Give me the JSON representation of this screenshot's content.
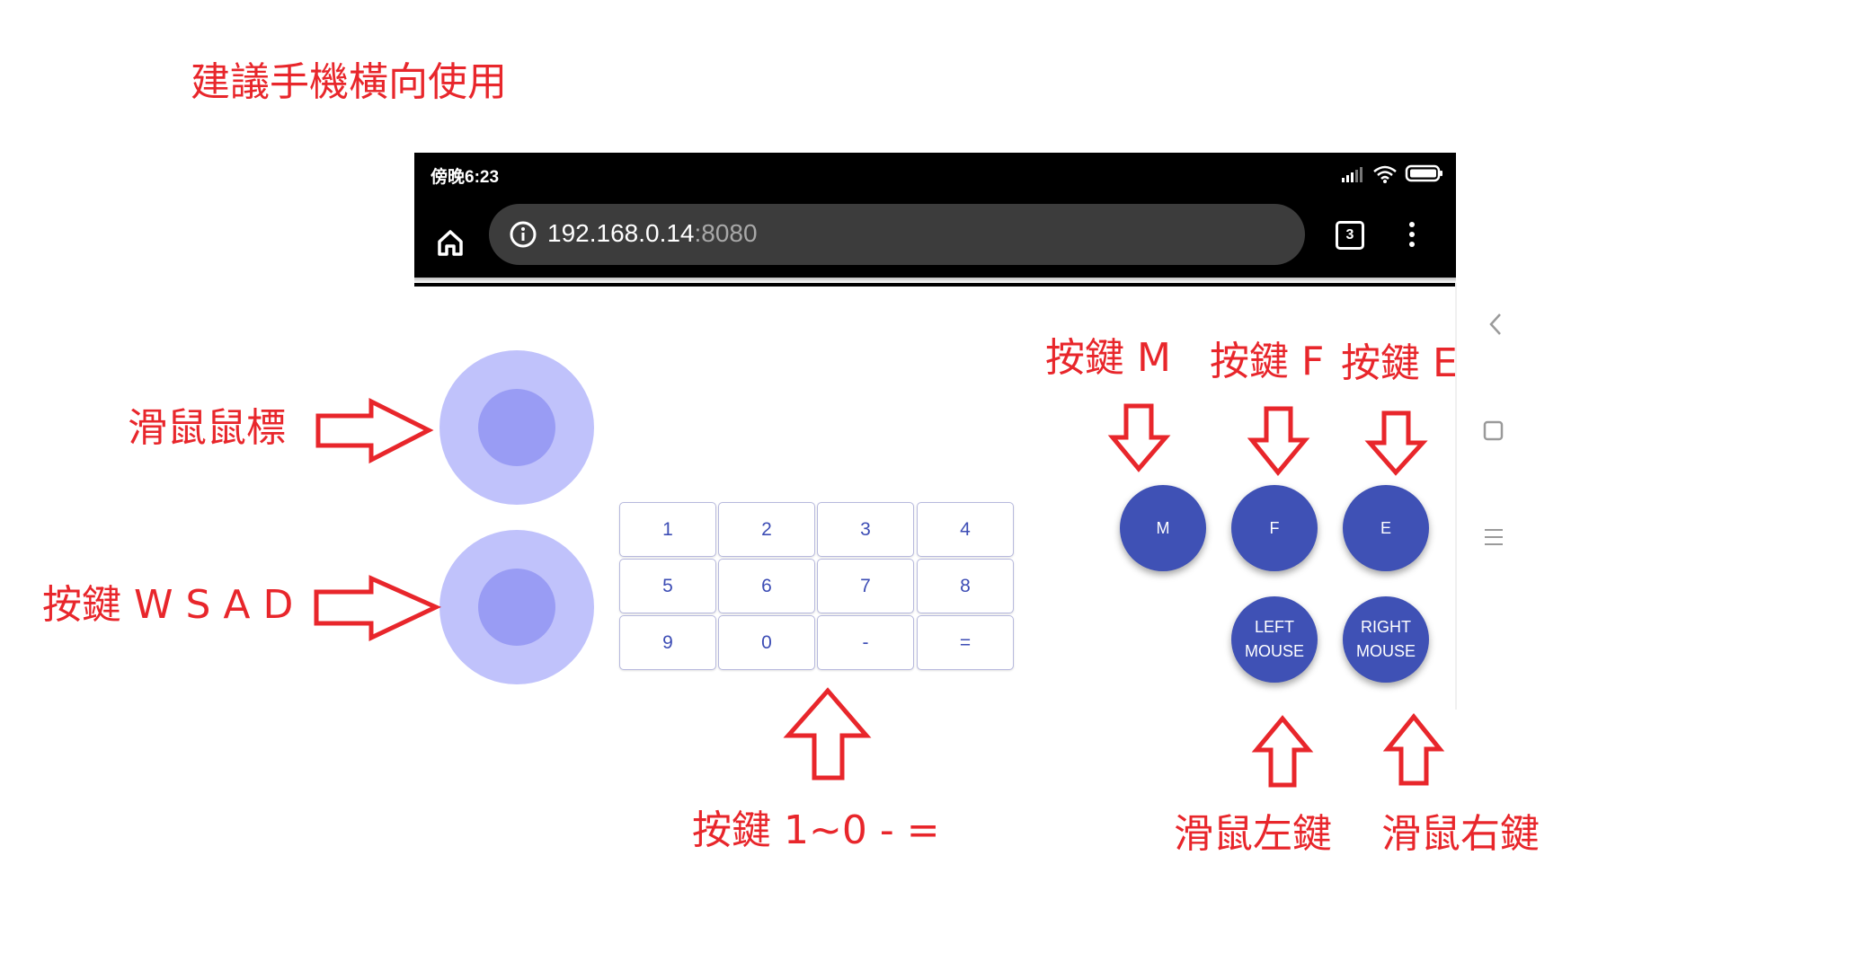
{
  "annotations": {
    "landscape_hint": "建議手機橫向使用",
    "mouse_cursor": "滑鼠鼠標",
    "wsad_keys": "按鍵 W S A D",
    "key_m": "按鍵 M",
    "key_f": "按鍵 F",
    "key_e": "按鍵 E",
    "number_keys": "按鍵 1~0 - =",
    "mouse_left": "滑鼠左鍵",
    "mouse_right": "滑鼠右鍵"
  },
  "status_bar": {
    "time": "傍晚6:23",
    "icons": [
      "signal-icon",
      "wifi-icon",
      "battery-icon"
    ]
  },
  "browser": {
    "url_host": "192.168.0.14",
    "url_port": ":8080",
    "tab_count": "3",
    "icons": [
      "home-icon",
      "info-icon",
      "tabs-icon",
      "more-vert-icon"
    ]
  },
  "side_nav_icons": [
    "back-chevron-icon",
    "square-icon",
    "menu-lines-icon"
  ],
  "keypad": {
    "rows": [
      [
        "1",
        "2",
        "3",
        "4"
      ],
      [
        "5",
        "6",
        "7",
        "8"
      ],
      [
        "9",
        "0",
        "-",
        "="
      ]
    ]
  },
  "action_buttons": {
    "m": "M",
    "f": "F",
    "e": "E",
    "left_mouse_line1": "LEFT",
    "left_mouse_line2": "MOUSE",
    "right_mouse_line1": "RIGHT",
    "right_mouse_line2": "MOUSE"
  },
  "colors": {
    "annotation_red": "#e8262b",
    "joystick_outer": "#c0c2fb",
    "joystick_inner": "#999cf4",
    "fab_blue": "#3f51b5",
    "key_text": "#3d4db5"
  }
}
